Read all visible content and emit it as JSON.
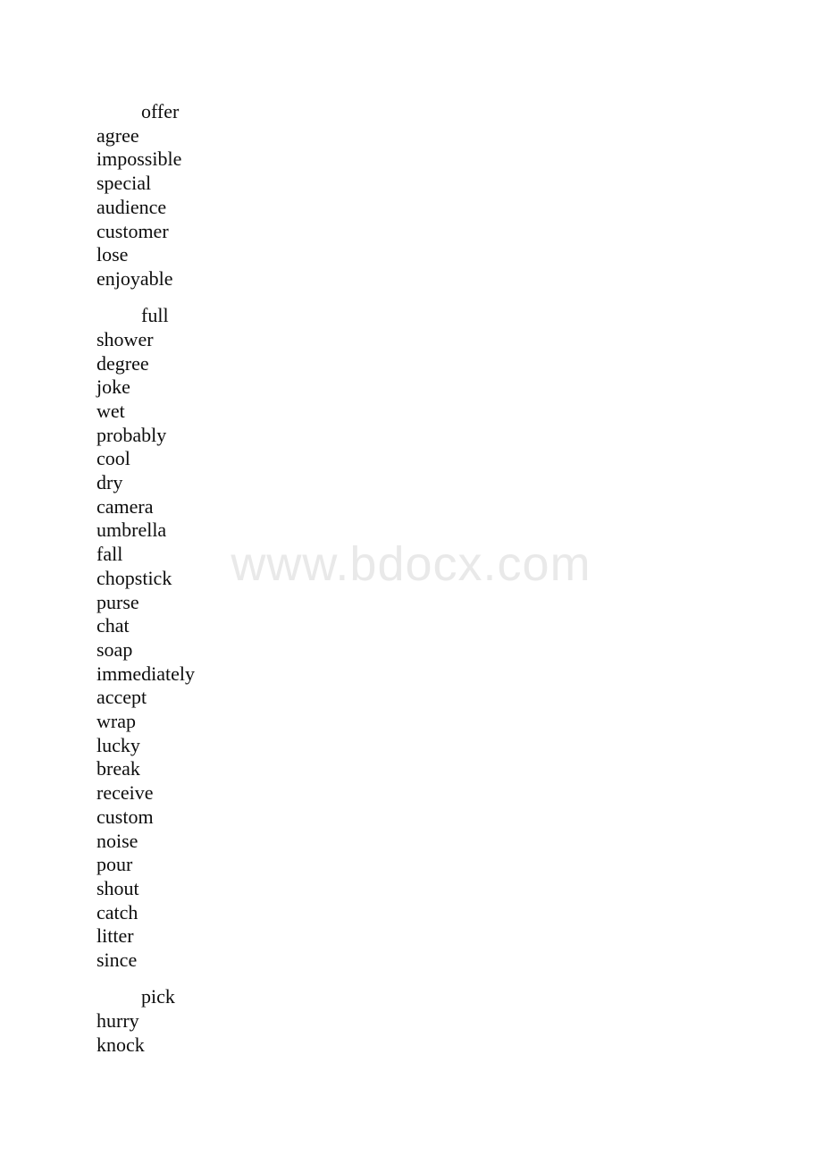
{
  "document": {
    "type": "vocabulary-word-list",
    "background_color": "#ffffff",
    "text_color": "#0d0d0d"
  },
  "watermark": {
    "text": "www.bdocx.com",
    "color": "#e9e9e9"
  },
  "groups": [
    {
      "head": "offer",
      "words": [
        "agree",
        "impossible",
        "special",
        "audience",
        "customer",
        "lose",
        "enjoyable"
      ]
    },
    {
      "head": "full",
      "words": [
        "shower",
        "degree",
        "joke",
        "wet",
        "probably",
        "cool",
        "dry",
        "camera",
        "umbrella",
        "fall",
        "chopstick",
        "purse",
        "chat",
        "soap",
        "immediately",
        "accept",
        "wrap",
        "lucky",
        "break",
        "receive",
        "custom",
        "noise",
        "pour",
        "shout",
        "catch",
        "litter",
        "since"
      ]
    },
    {
      "head": "pick",
      "words": [
        "hurry",
        "knock"
      ]
    }
  ]
}
